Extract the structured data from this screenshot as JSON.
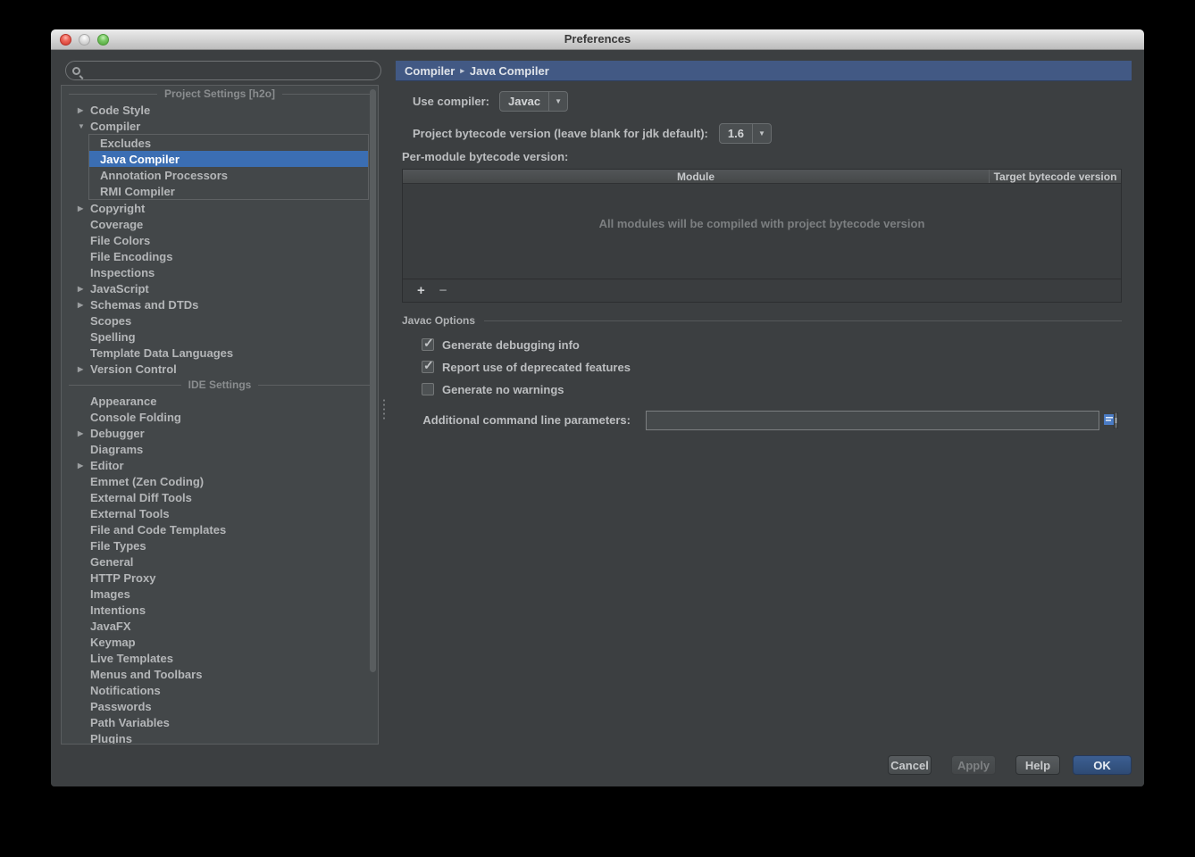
{
  "window": {
    "title": "Preferences"
  },
  "icons": {
    "chevron_right": "▶",
    "chevron_down": "▼",
    "combo_arrow": "▼",
    "crumb_sep": "▸",
    "plus": "+",
    "minus": "−"
  },
  "search": {
    "value": "",
    "placeholder": ""
  },
  "sidebar": {
    "project_header": "Project Settings [h2o]",
    "ide_header": "IDE Settings",
    "project_items": [
      {
        "label": "Code Style",
        "arrow": "right"
      },
      {
        "label": "Compiler",
        "arrow": "down",
        "children": [
          {
            "label": "Excludes"
          },
          {
            "label": "Java Compiler",
            "selected": true
          },
          {
            "label": "Annotation Processors"
          },
          {
            "label": "RMI Compiler"
          }
        ]
      },
      {
        "label": "Copyright",
        "arrow": "right"
      },
      {
        "label": "Coverage"
      },
      {
        "label": "File Colors"
      },
      {
        "label": "File Encodings"
      },
      {
        "label": "Inspections"
      },
      {
        "label": "JavaScript",
        "arrow": "right"
      },
      {
        "label": "Schemas and DTDs",
        "arrow": "right"
      },
      {
        "label": "Scopes"
      },
      {
        "label": "Spelling"
      },
      {
        "label": "Template Data Languages"
      },
      {
        "label": "Version Control",
        "arrow": "right"
      }
    ],
    "ide_items": [
      {
        "label": "Appearance"
      },
      {
        "label": "Console Folding"
      },
      {
        "label": "Debugger",
        "arrow": "right"
      },
      {
        "label": "Diagrams"
      },
      {
        "label": "Editor",
        "arrow": "right"
      },
      {
        "label": "Emmet (Zen Coding)"
      },
      {
        "label": "External Diff Tools"
      },
      {
        "label": "External Tools"
      },
      {
        "label": "File and Code Templates"
      },
      {
        "label": "File Types"
      },
      {
        "label": "General"
      },
      {
        "label": "HTTP Proxy"
      },
      {
        "label": "Images"
      },
      {
        "label": "Intentions"
      },
      {
        "label": "JavaFX"
      },
      {
        "label": "Keymap"
      },
      {
        "label": "Live Templates"
      },
      {
        "label": "Menus and Toolbars"
      },
      {
        "label": "Notifications"
      },
      {
        "label": "Passwords"
      },
      {
        "label": "Path Variables"
      },
      {
        "label": "Plugins"
      }
    ]
  },
  "breadcrumb": {
    "parent": "Compiler",
    "current": "Java Compiler"
  },
  "main": {
    "use_compiler_label": "Use compiler:",
    "use_compiler_value": "Javac",
    "bytecode_label": "Project bytecode version (leave blank for jdk default):",
    "bytecode_value": "1.6",
    "per_module_label": "Per-module bytecode version:",
    "table": {
      "columns": [
        "Module",
        "Target bytecode version"
      ],
      "rows": [],
      "empty_text": "All modules will be compiled with project bytecode version"
    },
    "javac_options_label": "Javac Options",
    "checkboxes": [
      {
        "label": "Generate debugging info",
        "checked": true
      },
      {
        "label": "Report use of deprecated features",
        "checked": true
      },
      {
        "label": "Generate no warnings",
        "checked": false
      }
    ],
    "additional_params_label": "Additional command line parameters:",
    "additional_params_value": ""
  },
  "footer": {
    "cancel": "Cancel",
    "apply": "Apply",
    "help": "Help",
    "ok": "OK"
  },
  "colors": {
    "panel": "#3c3f41",
    "selection": "#3b6eb3",
    "breadcrumb_bg": "#425984",
    "ok_button": "#34537e",
    "titlebar_text": "#3a3a3a"
  }
}
